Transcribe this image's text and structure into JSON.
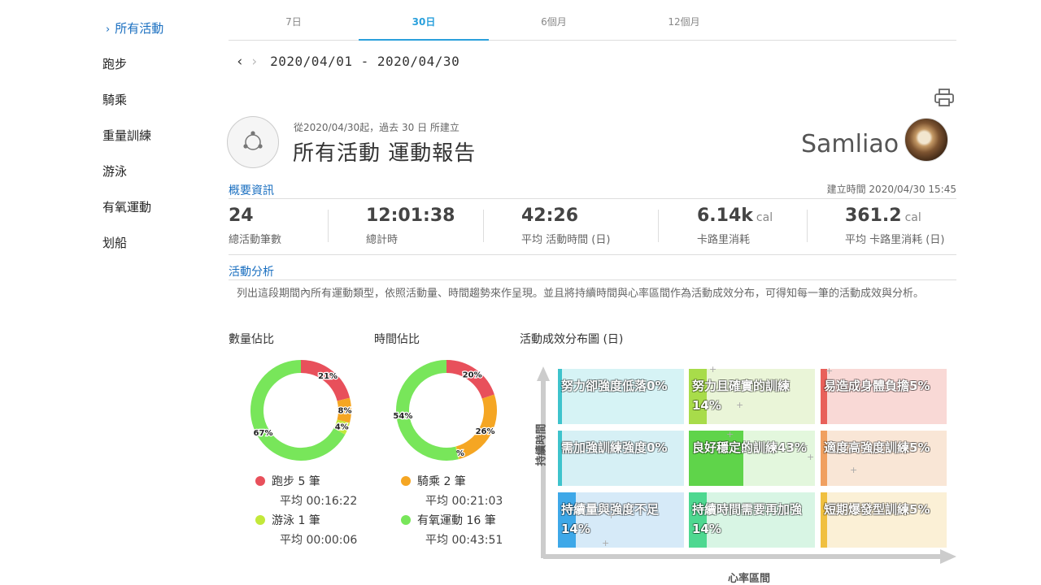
{
  "sidebar": {
    "items": [
      {
        "label": "所有活動",
        "active": true
      },
      {
        "label": "跑步"
      },
      {
        "label": "騎乘"
      },
      {
        "label": "重量訓練"
      },
      {
        "label": "游泳"
      },
      {
        "label": "有氧運動"
      },
      {
        "label": "划船"
      }
    ]
  },
  "tabs": [
    {
      "label": "7日"
    },
    {
      "label": "30日",
      "active": true
    },
    {
      "label": "6個月"
    },
    {
      "label": "12個月"
    }
  ],
  "date_range": "2020/04/01 - 2020/04/30",
  "report": {
    "subtitle": "從2020/04/30起，過去 30 日 所建立",
    "title": "所有活動 運動報告",
    "username": "Samliao"
  },
  "overview": {
    "title": "概要資訊",
    "created": "建立時間 2020/04/30 15:45",
    "stats": [
      {
        "value": "24",
        "unit": "",
        "label": "總活動筆數"
      },
      {
        "value": "12:01:38",
        "unit": "",
        "label": "總計時"
      },
      {
        "value": "42:26",
        "unit": "",
        "label": "平均 活動時間 (日)"
      },
      {
        "value": "6.14k",
        "unit": "cal",
        "label": "卡路里消耗"
      },
      {
        "value": "361.2",
        "unit": "cal",
        "label": "平均 卡路里消耗 (日)"
      }
    ]
  },
  "analysis": {
    "title": "活動分析",
    "desc": "列出這段期間內所有運動類型，依照活動量、時間趨勢來作呈現。並且將持續時間與心率區間作為活動成效分布，可得知每一筆的活動成效與分析。"
  },
  "chart_data": [
    {
      "type": "pie",
      "title": "數量佔比",
      "categories": [
        "跑步",
        "騎乘",
        "游泳",
        "有氧運動"
      ],
      "values": [
        21,
        8,
        4,
        67
      ],
      "labels": [
        "21%",
        "8%",
        "4%",
        "67%"
      ],
      "colors": [
        "#e8505b",
        "#f5a623",
        "#c3e83a",
        "#78e65a"
      ]
    },
    {
      "type": "pie",
      "title": "時間佔比",
      "categories": [
        "跑步",
        "騎乘",
        "游泳",
        "有氧運動"
      ],
      "values": [
        20,
        26,
        0.4,
        54
      ],
      "labels": [
        "20%",
        "26%",
        "0%",
        "54%"
      ],
      "colors": [
        "#e8505b",
        "#f5a623",
        "#c3e83a",
        "#78e65a"
      ]
    }
  ],
  "legend": [
    {
      "label": "跑步 5 筆",
      "avg": "平均 00:16:22",
      "color": "#e8505b"
    },
    {
      "label": "游泳 1 筆",
      "avg": "平均 00:00:06",
      "color": "#c3e83a"
    },
    {
      "label": "騎乘 2 筆",
      "avg": "平均 00:21:03",
      "color": "#f5a623"
    },
    {
      "label": "有氧運動 16 筆",
      "avg": "平均 00:43:51",
      "color": "#78e65a"
    }
  ],
  "matrix": {
    "title": "活動成效分布圖 (日)",
    "y_axis": "持續時間",
    "x_axis": "心率區間",
    "cells": [
      {
        "text": "努力卻強度低落0%",
        "pct": 0,
        "bg": "#d6f3f5",
        "fill": "#3ec3cc"
      },
      {
        "text": "努力且確實的訓練14%",
        "pct": 14,
        "bg": "#eaf5d8",
        "fill": "#a8dc4a"
      },
      {
        "text": "易造成身體負擔5%",
        "pct": 5,
        "bg": "#f9d9d6",
        "fill": "#e8605a"
      },
      {
        "text": "需加強訓練強度0%",
        "pct": 0,
        "bg": "#d6f0f5",
        "fill": "#3ec3cc"
      },
      {
        "text": "良好穩定的訓練43%",
        "pct": 43,
        "bg": "#e3f7dd",
        "fill": "#5fd44a"
      },
      {
        "text": "適度高強度訓練5%",
        "pct": 5,
        "bg": "#f9e6d6",
        "fill": "#f0a060"
      },
      {
        "text": "持續量與強度不足14%",
        "pct": 14,
        "bg": "#d6eaf8",
        "fill": "#3ea8e8"
      },
      {
        "text": "持續時間需要再加強14%",
        "pct": 14,
        "bg": "#d8f5e4",
        "fill": "#4ed890"
      },
      {
        "text": "短期爆發型訓練5%",
        "pct": 5,
        "bg": "#fbf0d6",
        "fill": "#f0c040"
      }
    ]
  }
}
